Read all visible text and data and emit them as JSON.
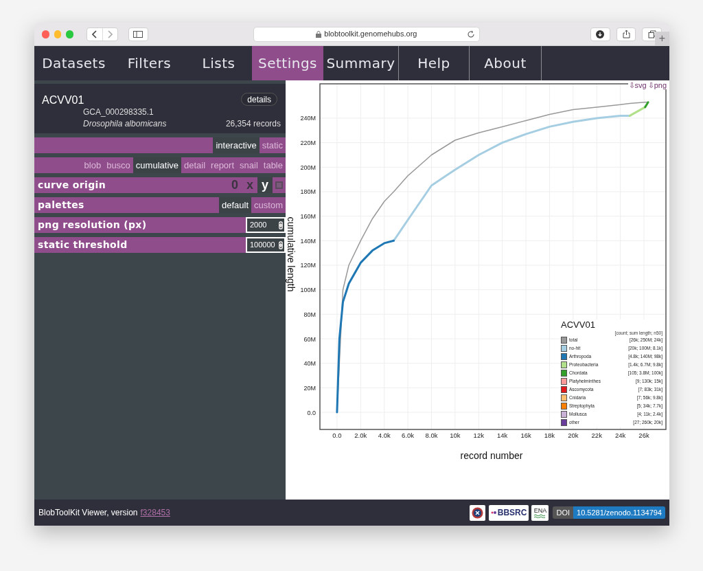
{
  "browser": {
    "url": "blobtoolkit.genomehubs.org",
    "new_tab": "+"
  },
  "nav": [
    {
      "label": "Datasets",
      "selected": false
    },
    {
      "label": "Filters",
      "selected": false
    },
    {
      "label": "Lists",
      "selected": false
    },
    {
      "label": "Settings",
      "selected": true
    },
    {
      "label": "Summary",
      "selected": false
    },
    {
      "label": "Help",
      "selected": false
    },
    {
      "label": "About",
      "selected": false
    }
  ],
  "dataset": {
    "name": "ACVV01",
    "details_button": "details",
    "accession": "GCA_000298335.1",
    "species": "Drosophila albomicans",
    "records": "26,354 records"
  },
  "settings": [
    {
      "kind": "toggle",
      "options": [
        {
          "label": "interactive",
          "selected": true
        },
        {
          "label": "static",
          "selected": false
        }
      ]
    },
    {
      "kind": "toggle",
      "options": [
        {
          "label": "blob",
          "selected": false
        },
        {
          "label": "busco",
          "selected": false
        },
        {
          "label": "cumulative",
          "selected": true
        },
        {
          "label": "detail",
          "selected": false
        },
        {
          "label": "report",
          "selected": false
        },
        {
          "label": "snail",
          "selected": false
        },
        {
          "label": "table",
          "selected": false
        }
      ]
    },
    {
      "kind": "origin",
      "label": "curve origin",
      "options": [
        {
          "label": "0",
          "selected": false
        },
        {
          "label": "x",
          "selected": false
        },
        {
          "label": "y",
          "selected": true
        }
      ]
    },
    {
      "kind": "toggle",
      "label": "palettes",
      "options": [
        {
          "label": "default",
          "selected": true
        },
        {
          "label": "custom",
          "selected": false
        }
      ]
    },
    {
      "kind": "number",
      "label": "png resolution (px)",
      "value": "2000"
    },
    {
      "kind": "number",
      "label": "static threshold",
      "value": "100000"
    }
  ],
  "downloads": [
    "⇩svg",
    "⇩png"
  ],
  "chart_data": {
    "type": "line",
    "xlabel": "record number",
    "ylabel": "cumulative length",
    "grid": true,
    "x": [
      0,
      200,
      500,
      1000,
      2000,
      3000,
      4000,
      4800,
      6000,
      8000,
      10000,
      12000,
      14000,
      16000,
      18000,
      20000,
      22000,
      24000,
      24800,
      26100,
      26354
    ],
    "series": [
      {
        "name": "total",
        "color": "#999999",
        "values": [
          0,
          null,
          100,
          120,
          140,
          158,
          172,
          180,
          193,
          210,
          222,
          228,
          233,
          238,
          243,
          247,
          249,
          251,
          252,
          253,
          253
        ]
      },
      {
        "name": "no-hit",
        "color": "#a6cee3",
        "values": [
          null,
          null,
          null,
          null,
          null,
          null,
          null,
          140,
          157,
          185,
          198,
          210,
          220,
          227,
          233,
          237,
          240,
          242,
          242,
          null,
          null
        ]
      },
      {
        "name": "Arthropoda",
        "color": "#1f78b4",
        "values": [
          0,
          60,
          90,
          105,
          122,
          132,
          138,
          140,
          null,
          null,
          null,
          null,
          null,
          null,
          null,
          null,
          null,
          null,
          null,
          null,
          null
        ]
      },
      {
        "name": "Proteobacteria",
        "color": "#b2df8a",
        "values": [
          null,
          null,
          null,
          null,
          null,
          null,
          null,
          null,
          null,
          null,
          null,
          null,
          null,
          null,
          null,
          null,
          null,
          null,
          242,
          249,
          null
        ]
      },
      {
        "name": "Chordata",
        "color": "#33a02c",
        "values": [
          null,
          null,
          null,
          null,
          null,
          null,
          null,
          null,
          null,
          null,
          null,
          null,
          null,
          null,
          null,
          null,
          null,
          null,
          null,
          249,
          253
        ]
      }
    ],
    "xlim": [
      -1450,
      27860
    ],
    "ylim": [
      -14,
      268
    ],
    "xticks": [
      {
        "value": 0,
        "label": "0.0"
      },
      {
        "value": 2000,
        "label": "2.0k"
      },
      {
        "value": 4000,
        "label": "4.0k"
      },
      {
        "value": 6000,
        "label": "6.0k"
      },
      {
        "value": 8000,
        "label": "8.0k"
      },
      {
        "value": 10000,
        "label": "10k"
      },
      {
        "value": 12000,
        "label": "12k"
      },
      {
        "value": 14000,
        "label": "14k"
      },
      {
        "value": 16000,
        "label": "16k"
      },
      {
        "value": 18000,
        "label": "18k"
      },
      {
        "value": 20000,
        "label": "20k"
      },
      {
        "value": 22000,
        "label": "22k"
      },
      {
        "value": 24000,
        "label": "24k"
      },
      {
        "value": 26000,
        "label": "26k"
      }
    ],
    "yticks": [
      {
        "value": 0,
        "label": "0.0"
      },
      {
        "value": 20,
        "label": "20M"
      },
      {
        "value": 40,
        "label": "40M"
      },
      {
        "value": 60,
        "label": "60M"
      },
      {
        "value": 80,
        "label": "80M"
      },
      {
        "value": 100,
        "label": "100M"
      },
      {
        "value": 120,
        "label": "120M"
      },
      {
        "value": 140,
        "label": "140M"
      },
      {
        "value": 160,
        "label": "160M"
      },
      {
        "value": 180,
        "label": "180M"
      },
      {
        "value": 200,
        "label": "200M"
      },
      {
        "value": 220,
        "label": "220M"
      },
      {
        "value": 240,
        "label": "240M"
      }
    ],
    "legend": {
      "title": "ACVV01",
      "header": "[count; sum length; n50]",
      "stats": [
        "[26k; 250M; 24k]",
        "[20k; 100M; 8.1k]",
        "[4.8k; 140M; 98k]",
        "[1.4k; 6.7M; 9.8k]",
        "[105; 3.8M; 100k]",
        "[9; 130k; 15k]",
        "[7; 83k; 31k]",
        "[7; 56k; 9.8k]",
        "[5; 34k; 7.7k]",
        "[4; 11k; 2.4k]",
        "[27; 260k; 20k]"
      ],
      "items": [
        {
          "label": "Platyhelminthes",
          "color": "#fb9a99"
        },
        {
          "label": "Ascomycota",
          "color": "#e31a1c"
        },
        {
          "label": "Cnidaria",
          "color": "#fdbf6f"
        },
        {
          "label": "Streptophyta",
          "color": "#ff7f00"
        },
        {
          "label": "Mollusca",
          "color": "#cab2d6"
        },
        {
          "label": "other",
          "color": "#6a3d9a"
        }
      ]
    }
  },
  "footer": {
    "text": "BlobToolKit Viewer, version",
    "version_link": "f328453",
    "bbsrc": "BBSRC",
    "ena": "ENA",
    "doi_label": "DOI",
    "doi": "10.5281/zenodo.1134794"
  }
}
